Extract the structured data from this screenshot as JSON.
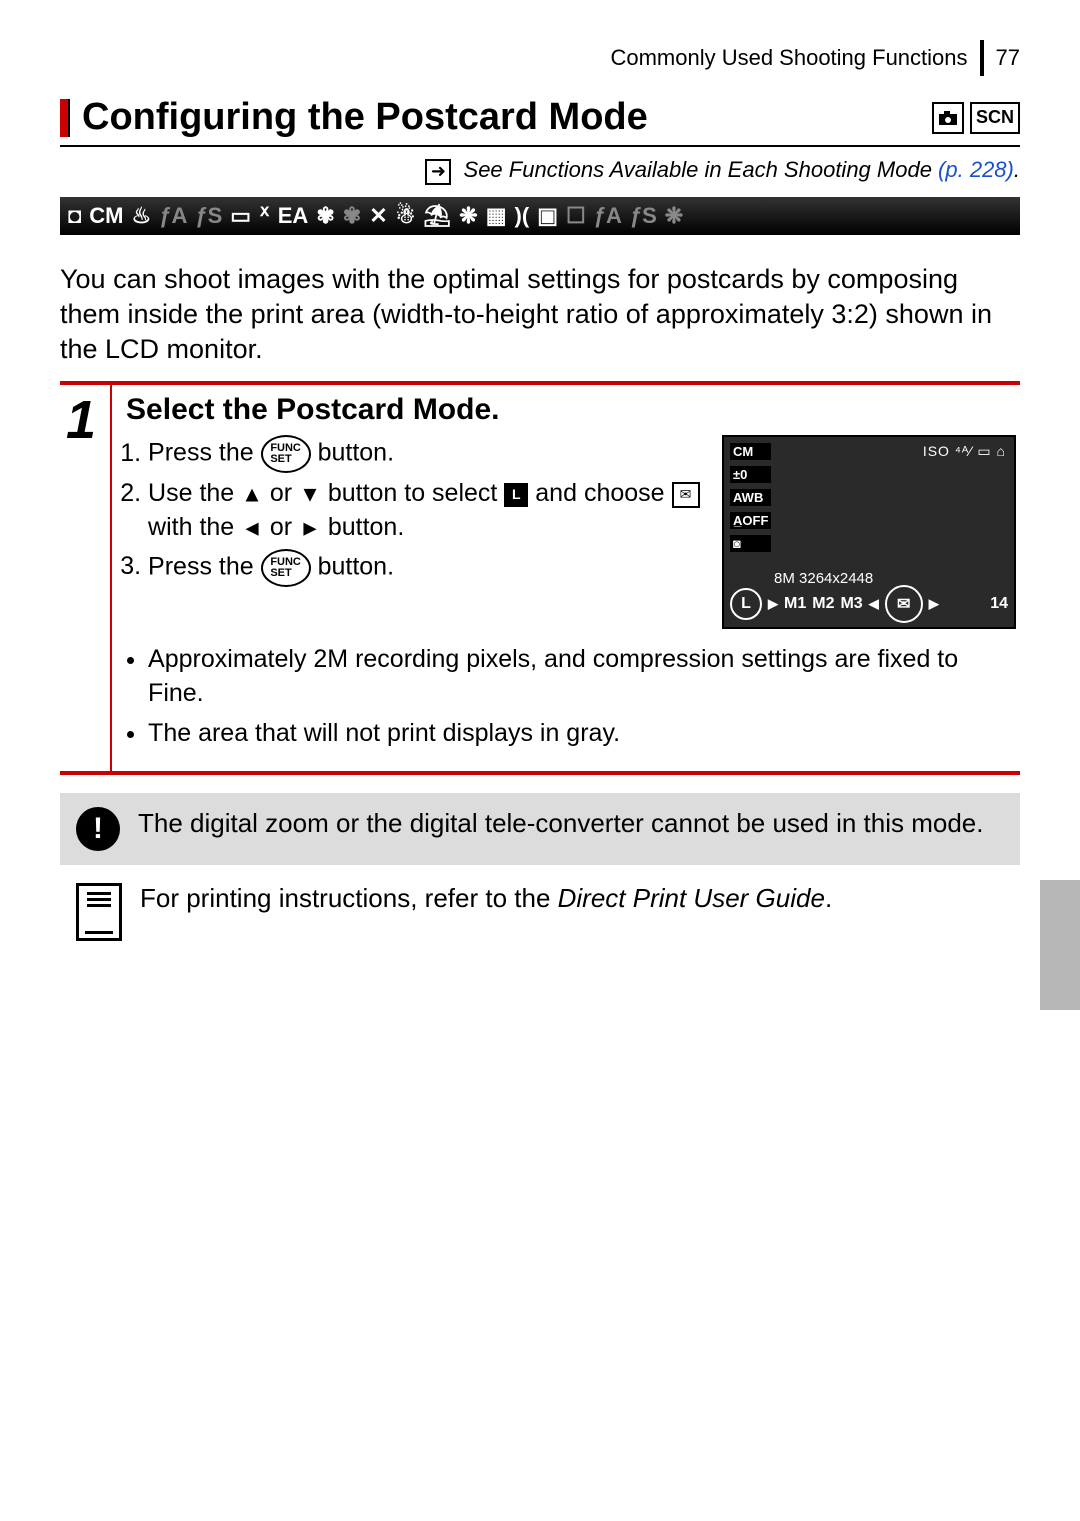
{
  "header": {
    "breadcrumb": "Commonly Used Shooting Functions",
    "page_number": "77"
  },
  "section": {
    "title": "Configuring the Postcard Mode",
    "badges": {
      "camera": "◉",
      "scn": "SCN"
    }
  },
  "see_link": {
    "prefix": "See Functions Available in Each Shooting Mode ",
    "ref": "(p. 228)",
    "suffix": "."
  },
  "intro": "You can shoot images with the optimal settings for postcards by composing them inside the print area (width-to-height ratio of approximately 3:2) shown in the LCD monitor.",
  "step": {
    "number": "1",
    "title": "Select the Postcard Mode.",
    "instr": {
      "i1a": "Press the ",
      "i1b": " button.",
      "i2a": "Use the ",
      "i2b": " or ",
      "i2c": " button to select ",
      "i2d": " and choose ",
      "i2e": " with the ",
      "i2f": " or ",
      "i2g": " button.",
      "i3a": "Press the ",
      "i3b": " button."
    },
    "bullets": {
      "b1": "Approximately 2M recording pixels, and compression settings are fixed to Fine.",
      "b2": "The area that will not print displays in gray."
    }
  },
  "lcd": {
    "mode": "CM",
    "ev": "±0",
    "wb": "AWB",
    "aoff": "A̲OFF",
    "meter": "◙",
    "topright": "ISO  ⁴ᴬ⁄  ▭  ⌂",
    "res": "8M  3264x2448",
    "size_L": "L",
    "m1": "M1",
    "m2": "M2",
    "m3": "M3",
    "shots": "14"
  },
  "warning": "The digital zoom or the digital tele-converter cannot be used in this mode.",
  "print_note_a": "For printing instructions, refer to the ",
  "print_note_guide": "Direct Print User Guide",
  "print_note_b": "."
}
